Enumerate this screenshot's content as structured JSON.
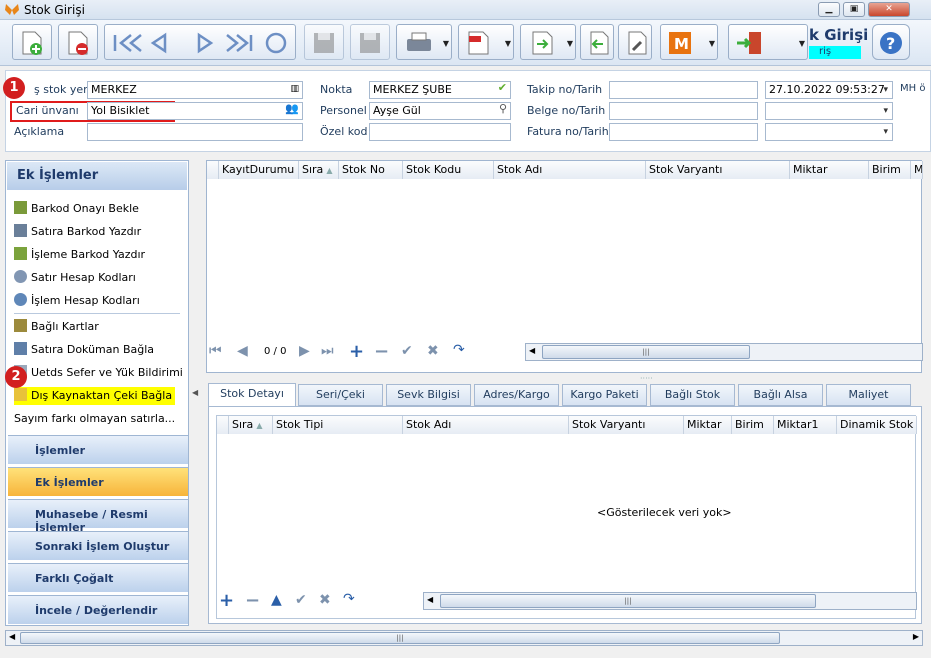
{
  "window": {
    "title": "Stok Girişi",
    "min": "▁",
    "max": "▣",
    "close": "✕"
  },
  "header": {
    "app_title": "k Girişi",
    "app_sub": "riş"
  },
  "form": {
    "cikis_label": "ş stok yeri",
    "cikis_value": "MERKEZ",
    "cari_label": "Cari ünvanı",
    "cari_value": "Yol Bisiklet",
    "aciklama_label": "Açıklama",
    "aciklama_value": "",
    "nokta_label": "Nokta",
    "nokta_value": "MERKEZ ŞUBE",
    "personel_label": "Personel",
    "personel_value": "Ayşe Gül",
    "ozelkod_label": "Özel kod",
    "ozelkod_value": "",
    "takip_label": "Takip no/Tarih",
    "takip_value": "",
    "takip_date": "27.10.2022 09:53:27",
    "belge_label": "Belge no/Tarih",
    "belge_value": "",
    "belge_date": "",
    "fatura_label": "Fatura no/Tarih",
    "fatura_value": "",
    "fatura_date": "",
    "mh_label": "MH ö"
  },
  "sidebar": {
    "title": "Ek İşlemler",
    "items": [
      "Barkod Onayı Bekle",
      "Satıra Barkod Yazdır",
      "İşleme Barkod Yazdır",
      "Satır Hesap Kodları",
      "İşlem Hesap Kodları",
      "Bağlı Kartlar",
      "Satıra Doküman Bağla",
      "Uetds Sefer ve Yük Bildirimi",
      "Dış Kaynaktan Çeki Bağla",
      "Sayım farkı olmayan satırla..."
    ],
    "categories": [
      "İşlemler",
      "Ek İşlemler",
      "Muhasebe / Resmi İşlemler",
      "Sonraki İşlem Oluştur",
      "Farklı Çoğalt",
      "İncele / Değerlendir"
    ]
  },
  "main_grid": {
    "columns": [
      "KayıtDurumu",
      "Sıra",
      "Stok No",
      "Stok Kodu",
      "Stok Adı",
      "Stok Varyantı",
      "Miktar",
      "Birim",
      "M"
    ],
    "pager": "0 / 0"
  },
  "tabs": [
    "Stok Detayı",
    "Seri/Çeki",
    "Sevk Bilgisi",
    "Adres/Kargo",
    "Kargo Paketi",
    "Bağlı Stok",
    "Bağlı Alsa",
    "Maliyet"
  ],
  "detail_grid": {
    "columns": [
      "Sıra",
      "Stok Tipi",
      "Stok Adı",
      "Stok Varyantı",
      "Miktar",
      "Birim",
      "Miktar1",
      "Dinamik Stok"
    ],
    "empty": "<Gösterilecek veri yok>"
  },
  "markers": [
    "1",
    "2"
  ],
  "scroll_grip": "|||",
  "colors": {
    "accent": "#1f3b6c",
    "highlight": "#ffff00",
    "marker": "#d21f1f"
  }
}
